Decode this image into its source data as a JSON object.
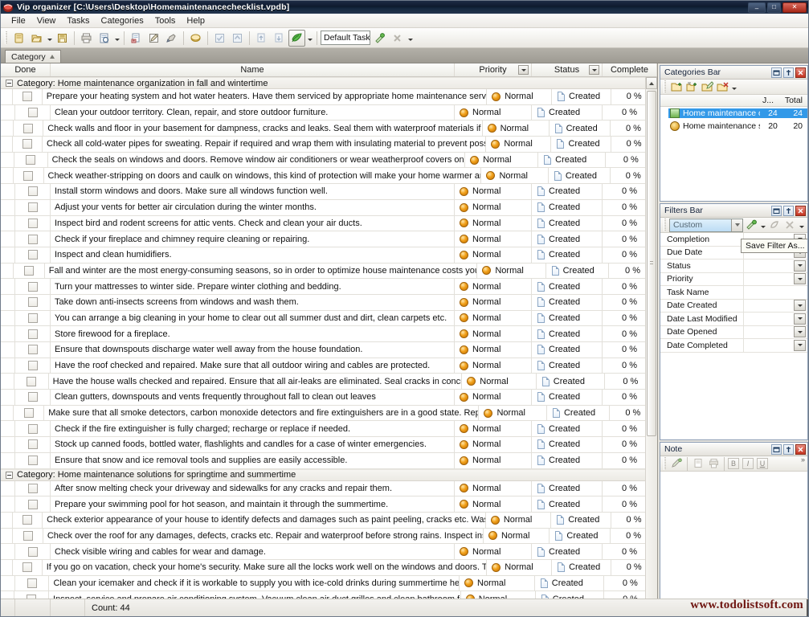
{
  "window": {
    "title": "Vip organizer [C:\\Users\\Desktop\\Homemaintenancechecklist.vpdb]",
    "app_icon": "vip-organizer-icon",
    "minimize_glyph": "–",
    "maximize_glyph": "□",
    "close_glyph": "✕"
  },
  "menu": {
    "items": [
      {
        "label": "File"
      },
      {
        "label": "View"
      },
      {
        "label": "Tasks"
      },
      {
        "label": "Categories"
      },
      {
        "label": "Tools"
      },
      {
        "label": "Help"
      }
    ]
  },
  "toolbar": {
    "task_combo_value": "Default Task",
    "buttons": [
      {
        "name": "new-database-icon"
      },
      {
        "name": "open-database-icon"
      },
      {
        "name": "save-database-icon"
      },
      {
        "name": "print-icon"
      },
      {
        "name": "print-preview-icon"
      },
      {
        "name": "new-task-icon"
      },
      {
        "name": "edit-task-icon"
      },
      {
        "name": "delete-task-icon"
      },
      {
        "name": "category-icon"
      },
      {
        "name": "mark-complete-icon"
      },
      {
        "name": "mark-incomplete-icon"
      },
      {
        "name": "move-up-icon"
      },
      {
        "name": "move-down-icon"
      },
      {
        "name": "export-icon"
      },
      {
        "name": "apply-template-icon"
      },
      {
        "name": "clear-template-icon"
      }
    ]
  },
  "group_tab": {
    "label": "Category",
    "sort": "ascending"
  },
  "grid": {
    "columns": [
      {
        "key": "done",
        "label": "Done",
        "filter": false
      },
      {
        "key": "name",
        "label": "Name",
        "filter": false
      },
      {
        "key": "priority",
        "label": "Priority",
        "filter": true
      },
      {
        "key": "status",
        "label": "Status",
        "filter": true
      },
      {
        "key": "complete",
        "label": "Complete",
        "filter": false
      }
    ],
    "groups": [
      {
        "label": "Category: Home maintenance organization in fall and wintertime",
        "expanded": true,
        "rows": [
          {
            "name": "Prepare your heating system and hot water heaters. Have them serviced by appropriate home maintenance services, change filters, get",
            "priority": "Normal",
            "status": "Created",
            "complete": "0 %",
            "done": false
          },
          {
            "name": "Clean your outdoor territory. Clean, repair, and store outdoor furniture.",
            "priority": "Normal",
            "status": "Created",
            "complete": "0 %",
            "done": false
          },
          {
            "name": "Check walls and floor in your basement for dampness, cracks and leaks. Seal them with waterproof materials if required. Test your",
            "priority": "Normal",
            "status": "Created",
            "complete": "0 %",
            "done": false
          },
          {
            "name": "Check all cold-water pipes for sweating. Repair if required and wrap them with insulating material to prevent possible freezing in winter.",
            "priority": "Normal",
            "status": "Created",
            "complete": "0 %",
            "done": false
          },
          {
            "name": "Check the seals on windows and doors. Remove window air conditioners or wear weatherproof covers on them.",
            "priority": "Normal",
            "status": "Created",
            "complete": "0 %",
            "done": false
          },
          {
            "name": "Check weather-stripping on doors and caulk on windows, this kind of protection will make your home warmer and will lower home",
            "priority": "Normal",
            "status": "Created",
            "complete": "0 %",
            "done": false
          },
          {
            "name": "Install storm windows and doors. Make sure all windows function well.",
            "priority": "Normal",
            "status": "Created",
            "complete": "0 %",
            "done": false
          },
          {
            "name": "Adjust your vents for better air circulation during the winter months.",
            "priority": "Normal",
            "status": "Created",
            "complete": "0 %",
            "done": false
          },
          {
            "name": "Inspect bird and rodent screens for attic vents. Check and clean your air ducts.",
            "priority": "Normal",
            "status": "Created",
            "complete": "0 %",
            "done": false
          },
          {
            "name": "Check if your fireplace and chimney require cleaning or repairing.",
            "priority": "Normal",
            "status": "Created",
            "complete": "0 %",
            "done": false
          },
          {
            "name": "Inspect and clean humidifiers.",
            "priority": "Normal",
            "status": "Created",
            "complete": "0 %",
            "done": false
          },
          {
            "name": "Fall and winter are the most energy-consuming seasons, so in order to optimize house maintenance costs you should create",
            "priority": "Normal",
            "status": "Created",
            "complete": "0 %",
            "done": false
          },
          {
            "name": "Turn your mattresses to winter side. Prepare winter clothing and bedding.",
            "priority": "Normal",
            "status": "Created",
            "complete": "0 %",
            "done": false
          },
          {
            "name": "Take down anti-insects screens from windows and wash them.",
            "priority": "Normal",
            "status": "Created",
            "complete": "0 %",
            "done": false
          },
          {
            "name": "You can arrange a big cleaning in your home to clear out all summer dust and dirt, clean carpets etc.",
            "priority": "Normal",
            "status": "Created",
            "complete": "0 %",
            "done": false
          },
          {
            "name": "Store firewood for a fireplace.",
            "priority": "Normal",
            "status": "Created",
            "complete": "0 %",
            "done": false
          },
          {
            "name": "Ensure that downspouts discharge water well away from the house foundation.",
            "priority": "Normal",
            "status": "Created",
            "complete": "0 %",
            "done": false
          },
          {
            "name": "Have the roof checked and repaired. Make sure that all outdoor wiring and cables are protected.",
            "priority": "Normal",
            "status": "Created",
            "complete": "0 %",
            "done": false
          },
          {
            "name": "Have the house walls checked and repaired. Ensure that all air-leaks are eliminated. Seal cracks in concrete.",
            "priority": "Normal",
            "status": "Created",
            "complete": "0 %",
            "done": false
          },
          {
            "name": "Clean gutters, downspouts and vents frequently throughout fall to clean out leaves",
            "priority": "Normal",
            "status": "Created",
            "complete": "0 %",
            "done": false
          },
          {
            "name": "Make sure that all smoke detectors, carbon monoxide detectors and fire extinguishers are in a good state. Replace batteries in",
            "priority": "Normal",
            "status": "Created",
            "complete": "0 %",
            "done": false
          },
          {
            "name": "Check if the fire extinguisher is fully charged; recharge or replace if needed.",
            "priority": "Normal",
            "status": "Created",
            "complete": "0 %",
            "done": false
          },
          {
            "name": "Stock up canned foods, bottled water, flashlights and candles for a case of winter emergencies.",
            "priority": "Normal",
            "status": "Created",
            "complete": "0 %",
            "done": false
          },
          {
            "name": "Ensure that snow and ice removal tools and supplies are easily accessible.",
            "priority": "Normal",
            "status": "Created",
            "complete": "0 %",
            "done": false
          }
        ]
      },
      {
        "label": "Category: Home maintenance solutions for springtime and summertime",
        "expanded": true,
        "rows": [
          {
            "name": "After snow melting check your driveway and sidewalks for any cracks and repair them.",
            "priority": "Normal",
            "status": "Created",
            "complete": "0 %",
            "done": false
          },
          {
            "name": "Prepare your swimming pool for hot season, and maintain it through the summertime.",
            "priority": "Normal",
            "status": "Created",
            "complete": "0 %",
            "done": false
          },
          {
            "name": "Check exterior appearance of your house to identify defects and damages such as paint peeling, cracks etc. Wash windows and walls,",
            "priority": "Normal",
            "status": "Created",
            "complete": "0 %",
            "done": false
          },
          {
            "name": "Check over the roof for any damages, defects, cracks etc. Repair and waterproof before strong rains. Inspect inside the attic for any",
            "priority": "Normal",
            "status": "Created",
            "complete": "0 %",
            "done": false
          },
          {
            "name": "Check visible wiring and cables for wear and damage.",
            "priority": "Normal",
            "status": "Created",
            "complete": "0 %",
            "done": false
          },
          {
            "name": "If you go on vacation, check your home's security. Make sure all the locks work well on the windows and doors. Test your fire-prevention",
            "priority": "Normal",
            "status": "Created",
            "complete": "0 %",
            "done": false
          },
          {
            "name": "Clean your icemaker and check if it is workable to supply you with ice-cold drinks during summertime heat.",
            "priority": "Normal",
            "status": "Created",
            "complete": "0 %",
            "done": false
          },
          {
            "name": "Inspect, service and prepare air conditioning system. Vacuum clean air duct grilles and clean bathroom fans",
            "priority": "Normal",
            "status": "Created",
            "complete": "0 %",
            "done": false
          }
        ]
      }
    ]
  },
  "categories_panel": {
    "title": "Categories Bar",
    "toolbar_buttons": [
      {
        "name": "new-category-icon"
      },
      {
        "name": "new-subcategory-icon"
      },
      {
        "name": "edit-category-icon"
      },
      {
        "name": "delete-category-icon"
      }
    ],
    "columns": {
      "jobs": "J...",
      "total": "Total"
    },
    "rows": [
      {
        "label": "Home maintenance orga",
        "icon": "category-green-icon",
        "jobs": "24",
        "total": "24",
        "selected": true
      },
      {
        "label": "Home maintenance solut",
        "icon": "category-gold-icon",
        "jobs": "20",
        "total": "20",
        "selected": false
      }
    ]
  },
  "filters_panel": {
    "title": "Filters Bar",
    "combo_value": "Custom",
    "tooltip": "Save Filter As...",
    "toolbar_buttons": [
      {
        "name": "save-filter-icon"
      },
      {
        "name": "clear-filter-icon"
      },
      {
        "name": "delete-filter-icon"
      }
    ],
    "rows": [
      {
        "label": "Completion",
        "dropdown": true
      },
      {
        "label": "Due Date",
        "dropdown": true
      },
      {
        "label": "Status",
        "dropdown": true
      },
      {
        "label": "Priority",
        "dropdown": true
      },
      {
        "label": "Task Name",
        "dropdown": false
      },
      {
        "label": "Date Created",
        "dropdown": true
      },
      {
        "label": "Date Last Modified",
        "dropdown": true
      },
      {
        "label": "Date Opened",
        "dropdown": true
      },
      {
        "label": "Date Completed",
        "dropdown": true
      }
    ]
  },
  "note_panel": {
    "title": "Note",
    "toolbar_buttons": [
      {
        "name": "edit-note-icon"
      },
      {
        "name": "print-preview-note-icon"
      },
      {
        "name": "print-note-icon"
      },
      {
        "name": "bold-icon",
        "glyph": "B"
      },
      {
        "name": "italic-icon",
        "glyph": "I"
      },
      {
        "name": "underline-icon",
        "glyph": "U"
      }
    ],
    "overflow_glyph": "»"
  },
  "statusbar": {
    "count_label": "Count: 44"
  },
  "watermark": {
    "text": "www.todolistsoft.com"
  },
  "colors": {
    "titlebar": "#16283f",
    "selection": "#3399e8",
    "close_button": "#c43421",
    "priority_dot": "#f1a019",
    "watermark": "#6e1410"
  }
}
